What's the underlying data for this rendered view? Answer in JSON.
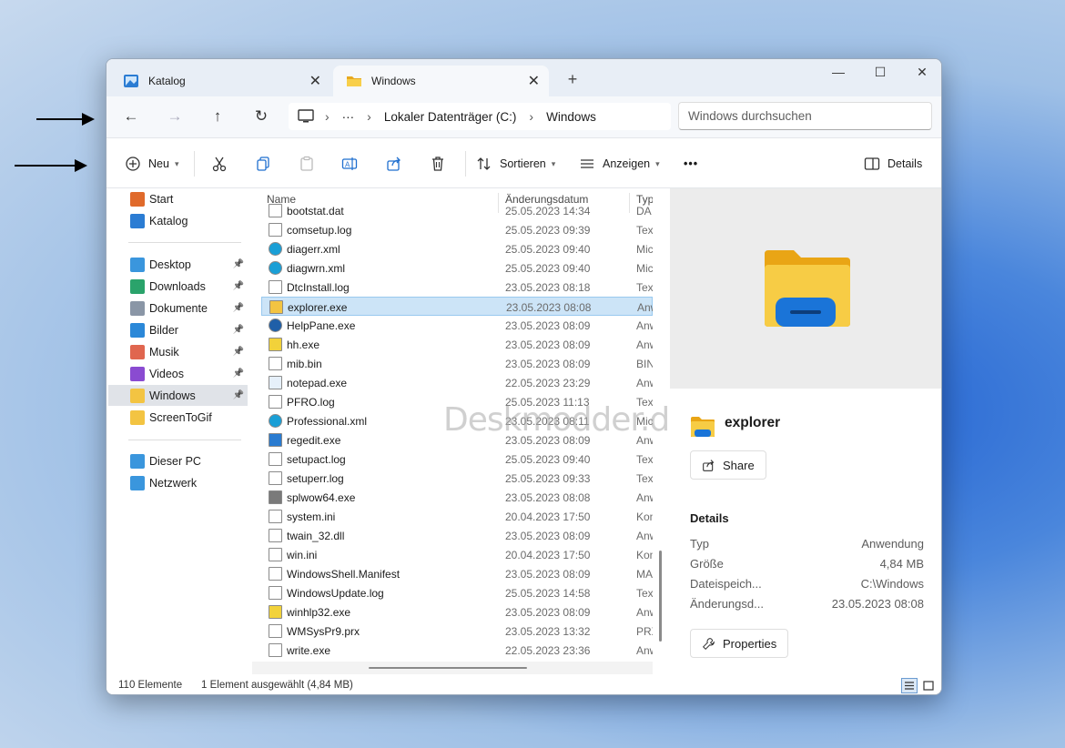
{
  "tabs": [
    {
      "label": "Katalog",
      "active": false
    },
    {
      "label": "Windows",
      "active": true
    }
  ],
  "window_controls": {
    "new_tab": "+",
    "minimize": "—",
    "maximize": "☐",
    "close": "✕"
  },
  "address": {
    "ellipsis": "···",
    "segments": [
      "Lokaler Datenträger (C:)",
      "Windows"
    ]
  },
  "search": {
    "placeholder": "Windows durchsuchen"
  },
  "command_bar": {
    "new_label": "Neu",
    "sort_label": "Sortieren",
    "view_label": "Anzeigen",
    "more": "•••",
    "details_label": "Details"
  },
  "sidebar": {
    "quick": [
      {
        "label": "Start",
        "icon": "home-icon",
        "color": "#e06a2b"
      },
      {
        "label": "Katalog",
        "icon": "gallery-icon",
        "color": "#2b7cd3"
      }
    ],
    "pinned": [
      {
        "label": "Desktop",
        "icon": "desktop-icon",
        "color": "#3a96dd"
      },
      {
        "label": "Downloads",
        "icon": "downloads-icon",
        "color": "#2aa36b"
      },
      {
        "label": "Dokumente",
        "icon": "documents-icon",
        "color": "#8a96a6"
      },
      {
        "label": "Bilder",
        "icon": "pictures-icon",
        "color": "#2b88d8"
      },
      {
        "label": "Musik",
        "icon": "music-icon",
        "color": "#e0664f"
      },
      {
        "label": "Videos",
        "icon": "videos-icon",
        "color": "#8a4bd1"
      },
      {
        "label": "Windows",
        "icon": "folder-icon",
        "color": "#f3c442",
        "selected": true
      },
      {
        "label": "ScreenToGif",
        "icon": "folder-icon",
        "color": "#f3c442",
        "nopin": true
      }
    ],
    "system": [
      {
        "label": "Dieser PC",
        "icon": "pc-icon",
        "color": "#3a96dd"
      },
      {
        "label": "Netzwerk",
        "icon": "network-icon",
        "color": "#3a96dd"
      }
    ]
  },
  "columns": {
    "name": "Name",
    "date": "Änderungsdatum",
    "type": "Typ"
  },
  "partial_row": {
    "name": "bootstat.dat",
    "date": "25.05.2023 14:34",
    "type": "DA"
  },
  "files": [
    {
      "name": "comsetup.log",
      "date": "25.05.2023 09:39",
      "type": "Text",
      "icon": "log-file-icon"
    },
    {
      "name": "diagerr.xml",
      "date": "25.05.2023 09:40",
      "type": "Mic",
      "icon": "edge-xml-icon"
    },
    {
      "name": "diagwrn.xml",
      "date": "25.05.2023 09:40",
      "type": "Mic",
      "icon": "edge-xml-icon"
    },
    {
      "name": "DtcInstall.log",
      "date": "23.05.2023 08:18",
      "type": "Text",
      "icon": "log-file-icon"
    },
    {
      "name": "explorer.exe",
      "date": "23.05.2023 08:08",
      "type": "Anw",
      "icon": "explorer-app-icon",
      "selected": true
    },
    {
      "name": "HelpPane.exe",
      "date": "23.05.2023 08:09",
      "type": "Anw",
      "icon": "help-icon"
    },
    {
      "name": "hh.exe",
      "date": "23.05.2023 08:09",
      "type": "Anw",
      "icon": "help-question-icon"
    },
    {
      "name": "mib.bin",
      "date": "23.05.2023 08:09",
      "type": "BIN",
      "icon": "file-icon"
    },
    {
      "name": "notepad.exe",
      "date": "22.05.2023 23:29",
      "type": "Anw",
      "icon": "notepad-icon"
    },
    {
      "name": "PFRO.log",
      "date": "25.05.2023 11:13",
      "type": "Text",
      "icon": "log-file-icon"
    },
    {
      "name": "Professional.xml",
      "date": "23.05.2023 08:11",
      "type": "Mic",
      "icon": "edge-xml-icon"
    },
    {
      "name": "regedit.exe",
      "date": "23.05.2023 08:09",
      "type": "Anw",
      "icon": "regedit-icon"
    },
    {
      "name": "setupact.log",
      "date": "25.05.2023 09:40",
      "type": "Text",
      "icon": "log-file-icon"
    },
    {
      "name": "setuperr.log",
      "date": "25.05.2023 09:33",
      "type": "Text",
      "icon": "log-file-icon"
    },
    {
      "name": "splwow64.exe",
      "date": "23.05.2023 08:08",
      "type": "Anw",
      "icon": "printer-icon"
    },
    {
      "name": "system.ini",
      "date": "20.04.2023 17:50",
      "type": "Kon",
      "icon": "settings-file-icon"
    },
    {
      "name": "twain_32.dll",
      "date": "23.05.2023 08:09",
      "type": "Anw",
      "icon": "dll-file-icon"
    },
    {
      "name": "win.ini",
      "date": "20.04.2023 17:50",
      "type": "Kon",
      "icon": "settings-file-icon"
    },
    {
      "name": "WindowsShell.Manifest",
      "date": "23.05.2023 08:09",
      "type": "MA",
      "icon": "file-icon"
    },
    {
      "name": "WindowsUpdate.log",
      "date": "25.05.2023 14:58",
      "type": "Text",
      "icon": "log-file-icon"
    },
    {
      "name": "winhlp32.exe",
      "date": "23.05.2023 08:09",
      "type": "Anw",
      "icon": "help-question-icon"
    },
    {
      "name": "WMSysPr9.prx",
      "date": "23.05.2023 13:32",
      "type": "PRX",
      "icon": "file-icon"
    },
    {
      "name": "write.exe",
      "date": "22.05.2023 23:36",
      "type": "Anw",
      "icon": "write-icon"
    }
  ],
  "watermark": "Deskmodder.de",
  "details_pane": {
    "name": "explorer",
    "share_label": "Share",
    "heading": "Details",
    "rows": [
      {
        "key": "Typ",
        "value": "Anwendung"
      },
      {
        "key": "Größe",
        "value": "4,84 MB"
      },
      {
        "key": "Dateispeich...",
        "value": "C:\\Windows"
      },
      {
        "key": "Änderungsd...",
        "value": "23.05.2023 08:08"
      }
    ],
    "properties_label": "Properties"
  },
  "status": {
    "count": "110 Elemente",
    "selection": "1 Element ausgewählt (4,84 MB)"
  }
}
